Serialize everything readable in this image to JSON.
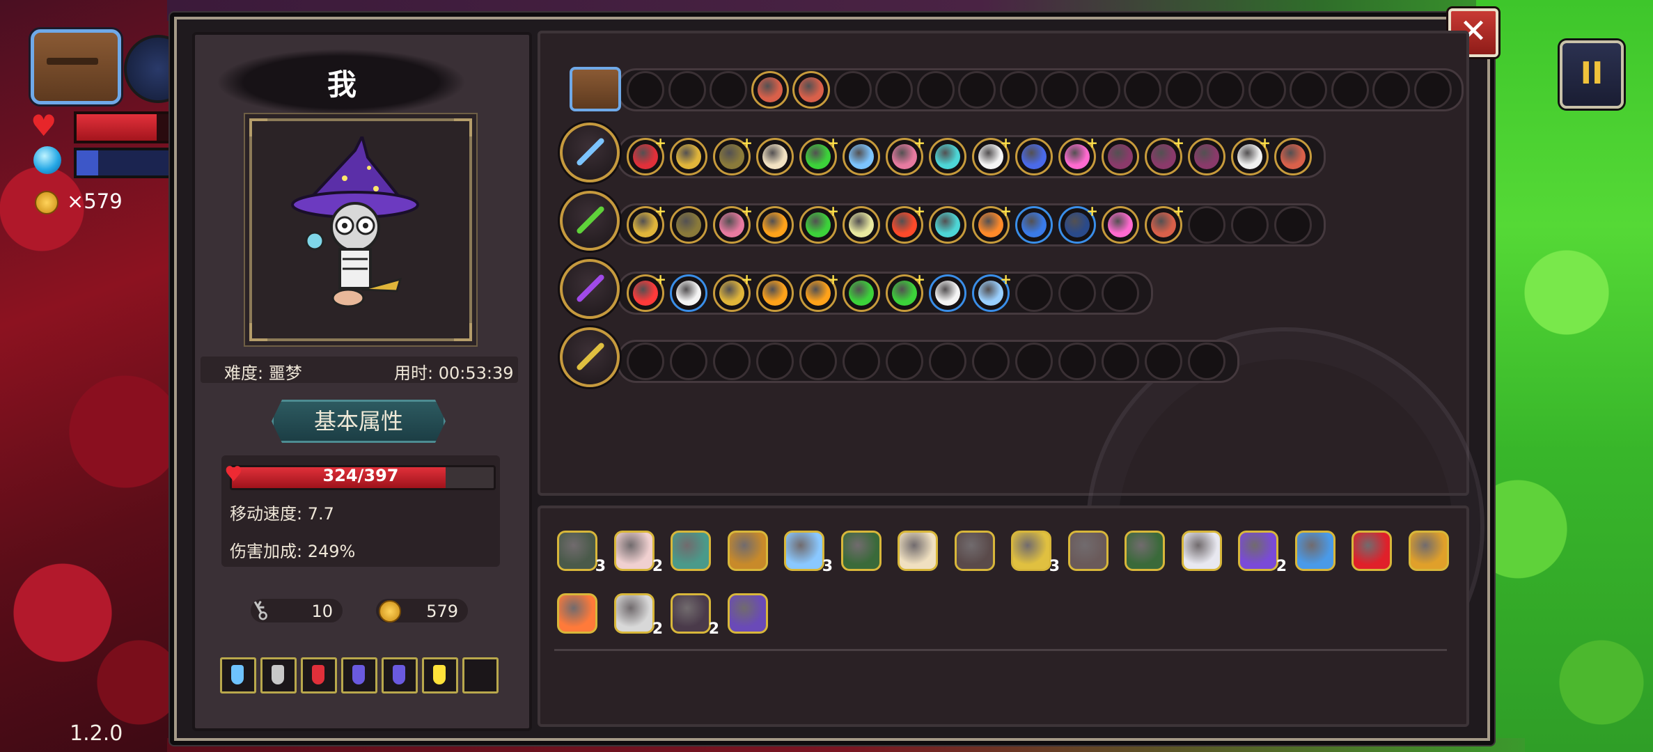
{
  "hud": {
    "coin_text": "×579",
    "version": "1.2.0",
    "pause_label": "II",
    "hp_fraction": 0.82,
    "mp_fraction": 0.22
  },
  "dialog": {
    "close_label": "✕"
  },
  "character": {
    "name": "我",
    "difficulty_label": "难度: 噩梦",
    "time_label": "用时: 00:53:39",
    "attributes_title": "基本属性",
    "hp_text": "324/397",
    "hp_current": 324,
    "hp_max": 397,
    "move_speed": "移动速度: 7.7",
    "damage_bonus": "伤害加成: 249%",
    "keys": "10",
    "coins": "579"
  },
  "potions": [
    {
      "color": "#6ec3ff"
    },
    {
      "color": "#c8c8c8"
    },
    {
      "color": "#e0303a"
    },
    {
      "color": "#6a5adf"
    },
    {
      "color": "#6a5adf"
    },
    {
      "color": "#ffe23a"
    },
    {
      "color": ""
    }
  ],
  "weapon_rows": [
    {
      "weapon": "treasure-chest",
      "slots": [
        "",
        "",
        "",
        "#d9604a",
        "#d9604a",
        "",
        "",
        "",
        "",
        "",
        "",
        "",
        "",
        "",
        "",
        "",
        "",
        "",
        "",
        ""
      ]
    },
    {
      "weapon": "ice-staff",
      "slots": [
        "#e0303a",
        "#e0b53a",
        "#8a7a3a",
        "#f2e2c2",
        "#3cd23a",
        "#7cc4ff",
        "#e77aa0",
        "#4dd6d6",
        "#f4f4f4",
        "#4a6ae8",
        "#ff6ad0",
        "#8a3a6a",
        "#8a3a6a",
        "#8a3a6a",
        "#f0f0f0",
        "#d9604a"
      ]
    },
    {
      "weapon": "vine-staff",
      "slots": [
        "#e0b53a",
        "#8a7a3a",
        "#e77aa0",
        "#ffa21a",
        "#3cd23a",
        "#e8e8a0",
        "#ff4a2a",
        "#4dd6d6",
        "#ff8a2a",
        "#3a7ae8",
        "#2a4a8a",
        "#ff6ad0",
        "#d9604a",
        "",
        "",
        ""
      ]
    },
    {
      "weapon": "void-staff",
      "slots": [
        "#ff3a3a",
        "#f4f4f4",
        "#e0b53a",
        "#ffa21a",
        "#ffa21a",
        "#3cd23a",
        "#3cd23a",
        "#f4f4f4",
        "#9ad0ff",
        "",
        "",
        ""
      ]
    },
    {
      "weapon": "gold-staff",
      "slots": [
        "",
        "",
        "",
        "",
        "",
        "",
        "",
        "",
        "",
        "",
        "",
        "",
        "",
        ""
      ]
    }
  ],
  "items": [
    {
      "name": "plague-mask",
      "color": "#4a5a4a",
      "count": "3"
    },
    {
      "name": "feather",
      "color": "#f0d0d0",
      "count": "2"
    },
    {
      "name": "cube",
      "color": "#4a9a8a",
      "count": ""
    },
    {
      "name": "chalice",
      "color": "#c88a2a",
      "count": ""
    },
    {
      "name": "magnifier",
      "color": "#8ac8ff",
      "count": "3"
    },
    {
      "name": "boot",
      "color": "#3a6a3a",
      "count": ""
    },
    {
      "name": "glasses",
      "color": "#f0e0c0",
      "count": ""
    },
    {
      "name": "bat-wing",
      "color": "#5a4a4a",
      "count": ""
    },
    {
      "name": "antler",
      "color": "#e0c040",
      "count": "3"
    },
    {
      "name": "bone",
      "color": "#6a5a5a",
      "count": ""
    },
    {
      "name": "belt",
      "color": "#3a6a3a",
      "count": ""
    },
    {
      "name": "cat-mask",
      "color": "#e8e8f0",
      "count": ""
    },
    {
      "name": "witch-hat",
      "color": "#7a4ad8",
      "count": "2"
    },
    {
      "name": "ring",
      "color": "#4a9ae8",
      "count": ""
    },
    {
      "name": "red-eye",
      "color": "#e0202a",
      "count": ""
    },
    {
      "name": "pickaxe",
      "color": "#e0a02a",
      "count": ""
    },
    {
      "name": "heart",
      "color": "#ff7a3a",
      "count": ""
    },
    {
      "name": "cage",
      "color": "#d8d8d8",
      "count": "2"
    },
    {
      "name": "hook",
      "color": "#4a3a4a",
      "count": "2"
    },
    {
      "name": "banner",
      "color": "#6a4ab8",
      "count": ""
    }
  ]
}
